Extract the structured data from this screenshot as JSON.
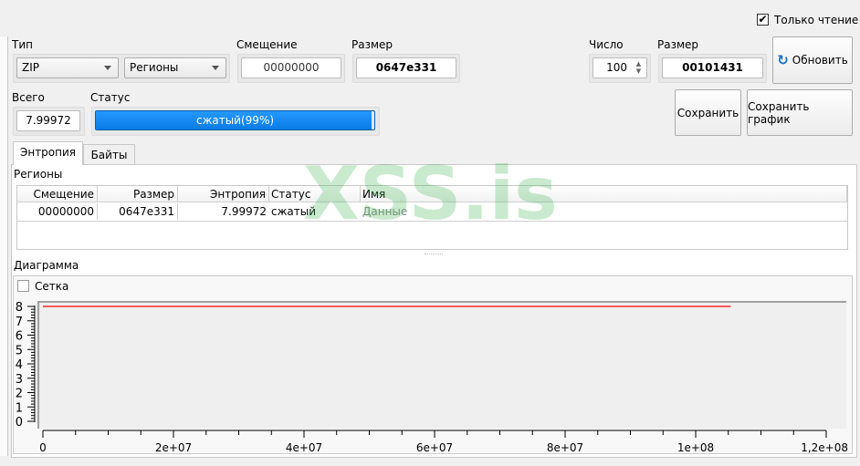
{
  "watermark": "XSS.is",
  "readonly": {
    "label": "Только чтение",
    "checked": true
  },
  "type": {
    "label": "Тип",
    "format": "ZIP",
    "mode": "Регионы"
  },
  "offset": {
    "label": "Смещение",
    "value": "00000000"
  },
  "size": {
    "label": "Размер",
    "value": "0647e331"
  },
  "count": {
    "label": "Число",
    "value": "100"
  },
  "block_size": {
    "label": "Размер",
    "value": "00101431"
  },
  "refresh_label": "Обновить",
  "total": {
    "label": "Всего",
    "value": "7.99972"
  },
  "status": {
    "label": "Статус",
    "text": "сжатый(99%)",
    "progress": 99,
    "color": "#0a84ee"
  },
  "save_label": "Сохранить",
  "save_chart_label": "Сохранить график",
  "tabs": [
    {
      "label": "Энтропия",
      "active": true
    },
    {
      "label": "Байты",
      "active": false
    }
  ],
  "regions": {
    "title": "Регионы",
    "columns": [
      "Смещение",
      "Размер",
      "Энтропия",
      "Статус",
      "Имя"
    ],
    "rows": [
      [
        "00000000",
        "0647e331",
        "7.99972",
        "сжатый",
        "Данные"
      ]
    ]
  },
  "diagram": {
    "title": "Диаграмма",
    "grid_label": "Сетка",
    "grid_checked": false
  },
  "chart_data": {
    "type": "line",
    "series": [
      {
        "name": "entropy",
        "color": "#ff0000",
        "x": [
          0,
          105374513
        ],
        "y": [
          7.99972,
          7.99972
        ]
      }
    ],
    "xlim": [
      0,
      120000000
    ],
    "ylim": [
      0,
      8
    ],
    "xticks": [
      {
        "v": 0,
        "label": "0"
      },
      {
        "v": 20000000,
        "label": "2e+07"
      },
      {
        "v": 40000000,
        "label": "4e+07"
      },
      {
        "v": 60000000,
        "label": "6e+07"
      },
      {
        "v": 80000000,
        "label": "8e+07"
      },
      {
        "v": 100000000,
        "label": "1e+08"
      },
      {
        "v": 120000000,
        "label": "1,2e+08"
      }
    ],
    "yticks": [
      "0",
      "1",
      "2",
      "3",
      "4",
      "5",
      "6",
      "7",
      "8"
    ],
    "grid": false
  }
}
